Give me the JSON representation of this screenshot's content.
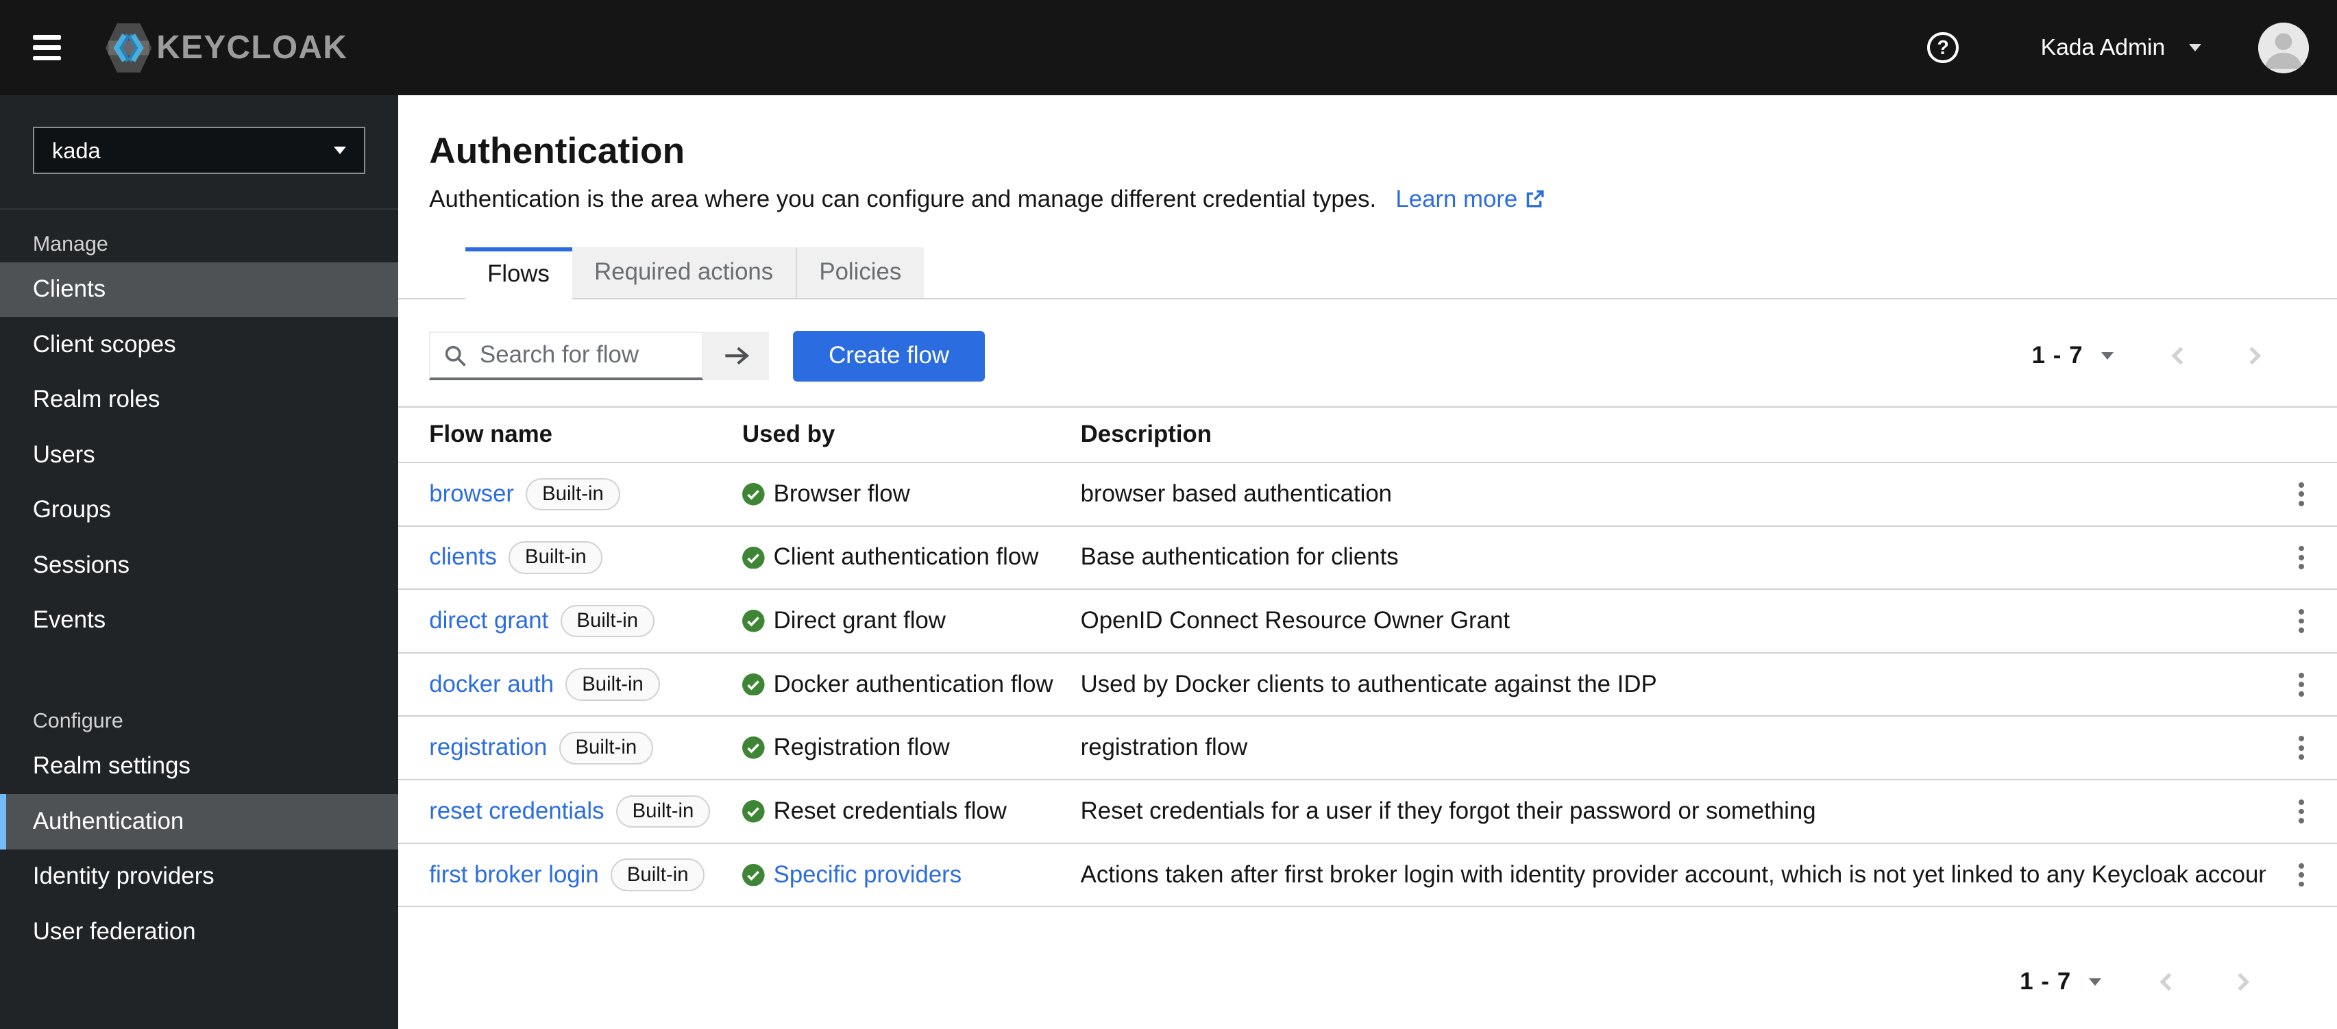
{
  "colors": {
    "accent": "#2b6de0",
    "success_green": "#3e8635",
    "masthead_bg": "#151515",
    "sidebar_bg": "#212427",
    "current_indicator": "#73bcf7",
    "disabled_gray": "#d2d2d2"
  },
  "masthead": {
    "brand": "KEYCLOAK",
    "icons": [
      "hamburger-icon",
      "keycloak-hexagon-icon",
      "question-circle-icon",
      "caret-down-icon",
      "avatar-icon"
    ],
    "user": {
      "name": "Kada Admin"
    }
  },
  "sidebar": {
    "realm_selector": {
      "value": "kada"
    },
    "sections": [
      {
        "label": "Manage",
        "items": [
          {
            "label": "Clients",
            "state": "hover"
          },
          {
            "label": "Client scopes",
            "state": "normal"
          },
          {
            "label": "Realm roles",
            "state": "normal"
          },
          {
            "label": "Users",
            "state": "normal"
          },
          {
            "label": "Groups",
            "state": "normal"
          },
          {
            "label": "Sessions",
            "state": "normal"
          },
          {
            "label": "Events",
            "state": "normal"
          }
        ]
      },
      {
        "label": "Configure",
        "items": [
          {
            "label": "Realm settings",
            "state": "normal"
          },
          {
            "label": "Authentication",
            "state": "current"
          },
          {
            "label": "Identity providers",
            "state": "normal"
          },
          {
            "label": "User federation",
            "state": "normal"
          }
        ]
      }
    ]
  },
  "page": {
    "title": "Authentication",
    "description": "Authentication is the area where you can configure and manage different credential types.",
    "learn_more_label": "Learn more",
    "learn_more_icon": "external-link-icon",
    "tabs": [
      {
        "label": "Flows",
        "active": true
      },
      {
        "label": "Required actions",
        "active": false
      },
      {
        "label": "Policies",
        "active": false
      }
    ],
    "toolbar": {
      "search_placeholder": "Search for flow",
      "search_icon": "search-icon",
      "search_submit_icon": "arrow-right-icon",
      "create_button_label": "Create flow"
    },
    "pagination": {
      "range": "1 - 7",
      "caret_icon": "caret-down-icon",
      "prev_icon": "angle-left-icon",
      "next_icon": "angle-right-icon",
      "prev_disabled": true,
      "next_disabled": true
    },
    "table": {
      "columns": [
        "Flow name",
        "Used by",
        "Description"
      ],
      "used_by_icon": "check-circle-icon",
      "row_menu_icon": "kebab-icon",
      "rows": [
        {
          "name": "browser",
          "badge": "Built-in",
          "used_by": "Browser flow",
          "used_by_is_link": false,
          "description": "browser based authentication"
        },
        {
          "name": "clients",
          "badge": "Built-in",
          "used_by": "Client authentication flow",
          "used_by_is_link": false,
          "description": "Base authentication for clients"
        },
        {
          "name": "direct grant",
          "badge": "Built-in",
          "used_by": "Direct grant flow",
          "used_by_is_link": false,
          "description": "OpenID Connect Resource Owner Grant"
        },
        {
          "name": "docker auth",
          "badge": "Built-in",
          "used_by": "Docker authentication flow",
          "used_by_is_link": false,
          "description": "Used by Docker clients to authenticate against the IDP"
        },
        {
          "name": "registration",
          "badge": "Built-in",
          "used_by": "Registration flow",
          "used_by_is_link": false,
          "description": "registration flow"
        },
        {
          "name": "reset credentials",
          "badge": "Built-in",
          "used_by": "Reset credentials flow",
          "used_by_is_link": false,
          "description": "Reset credentials for a user if they forgot their password or something"
        },
        {
          "name": "first broker login",
          "badge": "Built-in",
          "used_by": "Specific providers",
          "used_by_is_link": true,
          "description": "Actions taken after first broker login with identity provider account, which is not yet linked to any Keycloak account"
        }
      ]
    }
  }
}
